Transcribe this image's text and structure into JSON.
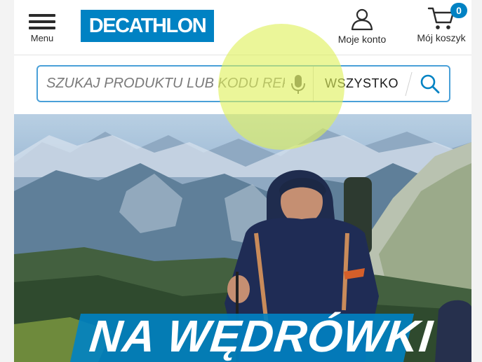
{
  "header": {
    "menu_label": "Menu",
    "logo_text": "DECATHLON",
    "account_label": "Moje konto",
    "cart_label": "Mój koszyk",
    "cart_count": "0"
  },
  "search": {
    "placeholder": "SZUKAJ PRODUKTU LUB KODU REFEI",
    "category": "WSZYSTKO"
  },
  "hero": {
    "title": "NA WĘDRÓWKI"
  },
  "colors": {
    "brand": "#0082c3",
    "search_border": "#4aa0d8"
  }
}
